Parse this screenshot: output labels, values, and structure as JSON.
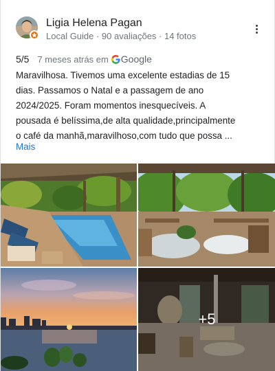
{
  "reviewer": {
    "name": "Ligia Helena Pagan",
    "meta": "Local Guide · 90 avaliações · 14 fotos"
  },
  "review": {
    "rating": "5/5",
    "time_ago": "7 meses atrás em",
    "source": "Google",
    "text": "Maravilhosa. Tivemos uma excelente estadias de 15\ndias. Passamos o Natal e a passagem de ano\n2024/2025. Foram momentos inesquecíveis. A\npousada é  belíssima,de alta qualidade,principalmente\no café da manhã,maravilhoso,com  tudo que possa ...",
    "more_label": "Mais"
  },
  "photos": {
    "items": [
      "pool-garden-photo",
      "restaurant-terrace-photo",
      "sunset-beach-photo",
      "lobby-interior-photo"
    ],
    "more_count": "+5"
  },
  "colors": {
    "link": "#1a73e8",
    "secondary_text": "#70757a",
    "local_guide_badge": "#e8710a"
  }
}
